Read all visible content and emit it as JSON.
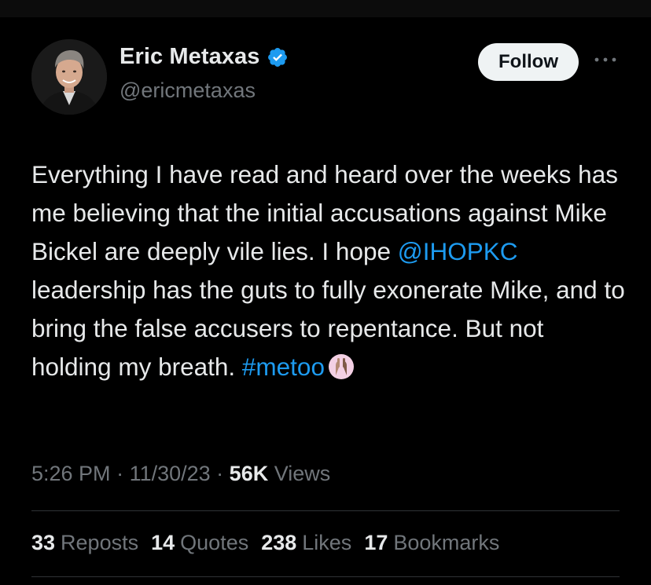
{
  "author": {
    "display_name": "Eric Metaxas",
    "handle": "@ericmetaxas",
    "verified": true,
    "avatar_icon": "profile-photo"
  },
  "actions": {
    "follow_label": "Follow",
    "more_icon": "more-horizontal-icon"
  },
  "tweet": {
    "text_before_mention": "Everything I have read and heard over the weeks has me believing that the initial accusations against Mike Bickel are deeply vile lies. I hope ",
    "mention": "@IHOPKC",
    "text_after_mention": " leadership has the guts to fully exonerate Mike, and to bring the false accusers to repentance. But not holding my breath. ",
    "hashtag": "#metoo",
    "emoji": "raised-hands-emoji"
  },
  "meta": {
    "time": "5:26 PM",
    "sep1": " · ",
    "date": "11/30/23",
    "sep2": " · ",
    "views_count": "56K",
    "views_label": " Views"
  },
  "stats": [
    {
      "count": "33",
      "label": "Reposts"
    },
    {
      "count": "14",
      "label": "Quotes"
    },
    {
      "count": "238",
      "label": "Likes"
    },
    {
      "count": "17",
      "label": "Bookmarks"
    }
  ],
  "colors": {
    "background": "#000000",
    "text": "#e7e9ea",
    "muted": "#71767b",
    "link": "#1d9bf0",
    "verified_badge": "#1d9bf0",
    "divider": "#2f3336"
  }
}
